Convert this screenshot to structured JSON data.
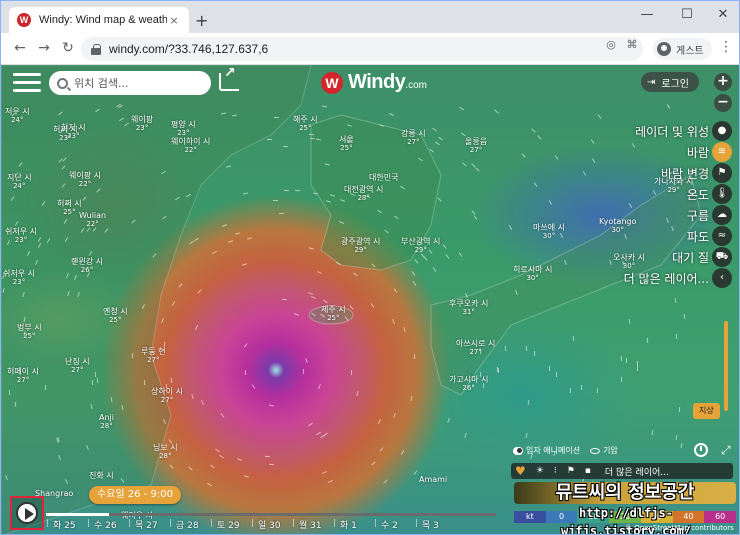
{
  "browser": {
    "tab_title": "Windy: Wind map & weather fo",
    "tab_close": "×",
    "new_tab": "+",
    "favicon_letter": "W",
    "minimize": "—",
    "maximize": "☐",
    "close": "✕",
    "url": "windy.com/?33.746,127.637,6",
    "profile_label": "게스트",
    "menu": "⋮"
  },
  "nav": {
    "back": "←",
    "forward": "→",
    "reload": "↻"
  },
  "app": {
    "search_placeholder": "위치 검색...",
    "logo_text": "Windy",
    "logo_suffix": ".com",
    "logo_mark": "W",
    "login_label": "로그인",
    "login_icon": "⇥",
    "zoom_in": "+",
    "zoom_out": "−"
  },
  "layers": [
    {
      "label": "레이더 및 위성",
      "icon": "satellite-icon",
      "glyph": "●"
    },
    {
      "label": "바람",
      "icon": "wind-icon",
      "glyph": "≋",
      "active": true
    },
    {
      "label": "바람 변경",
      "icon": "flag-icon",
      "glyph": "⚑"
    },
    {
      "label": "온도",
      "icon": "thermometer-icon",
      "glyph": "🌡"
    },
    {
      "label": "구름",
      "icon": "cloud-icon",
      "glyph": "☁"
    },
    {
      "label": "파도",
      "icon": "wave-icon",
      "glyph": "≈"
    },
    {
      "label": "대기 질",
      "icon": "car-icon",
      "glyph": "⛟"
    },
    {
      "label": "더 많은 레이어...",
      "icon": "chevron-left-icon",
      "glyph": "‹"
    }
  ],
  "ground_badge": "지상",
  "toggles": {
    "particles": "입자 애니메이션",
    "pressure": "기압"
  },
  "mini_bar": {
    "more": "더 많은 레이어..."
  },
  "overlay": {
    "blog_title": "뮤트씨의 정보공간",
    "blog_url": "http://dlfjs-wjfjs.tistory.com/"
  },
  "scale": [
    "kt",
    "0",
    "10",
    "20",
    "30",
    "40",
    "60"
  ],
  "credits": "© OpenStreetMap contributors",
  "timeline": {
    "current": "수요일 26 - 9:00",
    "days": [
      "화 25",
      "수 26",
      "목 27",
      "금 28",
      "토 29",
      "일 30",
      "월 31",
      "화 1",
      "수 2",
      "목 3"
    ],
    "progress": 0.14
  },
  "map_labels": [
    {
      "name": "저우 시",
      "temp": "24°"
    },
    {
      "name": "허저 시",
      "temp": "23°"
    },
    {
      "name": "웨이팡",
      "temp": "23°"
    },
    {
      "name": "평양 시",
      "temp": "23°"
    },
    {
      "name": "해주 시",
      "temp": "25°"
    },
    {
      "name": "허쩌 시",
      "temp": "23°"
    },
    {
      "name": "웨이하이 시",
      "temp": "22°"
    },
    {
      "name": "서울",
      "temp": "25°"
    },
    {
      "name": "강릉 시",
      "temp": "27°"
    },
    {
      "name": "울릉읍",
      "temp": "27°"
    },
    {
      "name": "지난 시",
      "temp": "24°"
    },
    {
      "name": "웨이팡 시",
      "temp": "22°"
    },
    {
      "name": "대한민국",
      "temp": ""
    },
    {
      "name": "대전광역 시",
      "temp": "28°"
    },
    {
      "name": "Wulian",
      "temp": "22°"
    },
    {
      "name": "쉬저우 시",
      "temp": "23°"
    },
    {
      "name": "광주광역 시",
      "temp": "29°"
    },
    {
      "name": "부산광역 시",
      "temp": "29°"
    },
    {
      "name": "마쓰에 시",
      "temp": "30°"
    },
    {
      "name": "Kyotango",
      "temp": "30°"
    },
    {
      "name": "가나자와 시",
      "temp": "29°"
    },
    {
      "name": "롄윈강 시",
      "temp": "26°"
    },
    {
      "name": "오사카 시",
      "temp": "30°"
    },
    {
      "name": "히로시마 시",
      "temp": "30°"
    },
    {
      "name": "쉬저우 시",
      "temp": "23°"
    },
    {
      "name": "제주 시",
      "temp": "25°"
    },
    {
      "name": "후쿠오카 시",
      "temp": "31°"
    },
    {
      "name": "옌청 시",
      "temp": "25°"
    },
    {
      "name": "벙부 시",
      "temp": "25°"
    },
    {
      "name": "아쓰시로 시",
      "temp": "27°"
    },
    {
      "name": "루둥 현",
      "temp": "27°"
    },
    {
      "name": "난징 시",
      "temp": "27°"
    },
    {
      "name": "허페이 시",
      "temp": "27°"
    },
    {
      "name": "가고시마 시",
      "temp": "26°"
    },
    {
      "name": "상하이 시",
      "temp": "27°"
    },
    {
      "name": "Anji",
      "temp": "28°"
    },
    {
      "name": "닝보 시",
      "temp": "28°"
    },
    {
      "name": "진화 시",
      "temp": ""
    },
    {
      "name": "Shangrao",
      "temp": ""
    },
    {
      "name": "Amami",
      "temp": ""
    },
    {
      "name": "웨저우 시",
      "temp": ""
    },
    {
      "name": "허쩌 시",
      "temp": "25°"
    }
  ]
}
